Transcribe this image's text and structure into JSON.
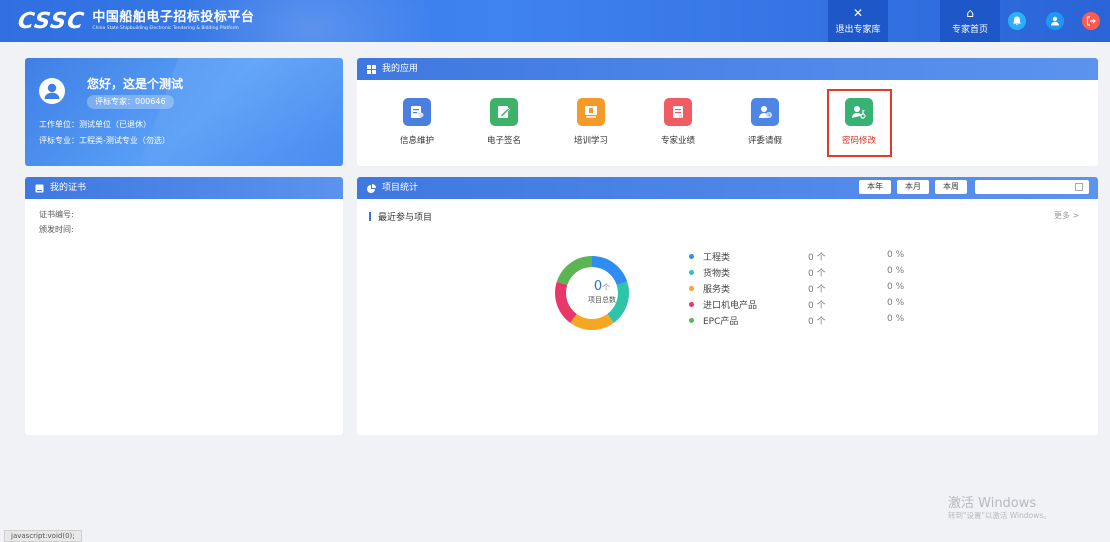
{
  "header": {
    "logo_mark": "CSSC",
    "title": "中国船舶电子招标投标平台",
    "subtitle": "China State Shipbuilding Electronic Tendering & Bidding Platform",
    "exit_label": "退出专家库",
    "home_label": "专家首页",
    "icons": [
      "close-icon",
      "home-icon",
      "bell-icon",
      "user-icon",
      "logout-icon"
    ]
  },
  "profile": {
    "greeting": "您好，这是个测试",
    "badge": "评标专家：000646",
    "unit": "工作单位：测试单位（已退休）",
    "major": "评标专业：工程类-测试专业（勿选）"
  },
  "apps": {
    "title": "我的应用",
    "items": [
      {
        "label": "信息维护",
        "color": "#4a7fe0",
        "icon": "profile-edit-icon"
      },
      {
        "label": "电子签名",
        "color": "#3fb26a",
        "icon": "signature-icon"
      },
      {
        "label": "培训学习",
        "color": "#f39a2b",
        "icon": "training-icon"
      },
      {
        "label": "专家业绩",
        "color": "#ef5d63",
        "icon": "performance-icon"
      },
      {
        "label": "评委请假",
        "color": "#4f86e6",
        "icon": "leave-icon"
      },
      {
        "label": "密码修改",
        "color": "#37b275",
        "icon": "password-icon"
      }
    ]
  },
  "certificate": {
    "title": "我的证书",
    "number_label": "证书编号:",
    "date_label": "颁发时间:"
  },
  "stats": {
    "title": "项目统计",
    "periods": [
      "本年",
      "本月",
      "本周"
    ],
    "recent_label": "最近参与项目",
    "more_label": "更多 >",
    "total_value": "0",
    "total_unit": "个",
    "total_label": "项目总数",
    "categories": [
      {
        "name": "工程类",
        "count": "0 个",
        "pct": "0 %",
        "color": "#2f8cf0"
      },
      {
        "name": "货物类",
        "count": "0 个",
        "pct": "0 %",
        "color": "#2ec4a9"
      },
      {
        "name": "服务类",
        "count": "0 个",
        "pct": "0 %",
        "color": "#f5a623"
      },
      {
        "name": "进口机电产品",
        "count": "0 个",
        "pct": "0 %",
        "color": "#e8386a"
      },
      {
        "name": "EPC产品",
        "count": "0 个",
        "pct": "0 %",
        "color": "#5ab552"
      }
    ]
  },
  "watermark": {
    "title": "激活 Windows",
    "subtitle": "转到\"设置\"以激活 Windows。"
  },
  "statusbar": "javascript:void(0);"
}
